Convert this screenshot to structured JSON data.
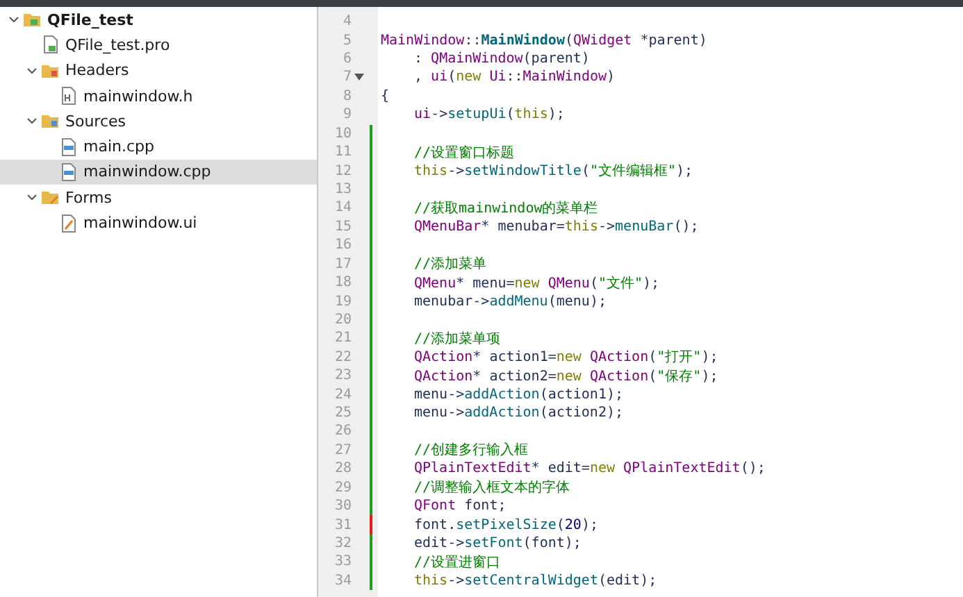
{
  "project_tree": [
    {
      "label": "QFile_test",
      "kind": "project",
      "expanded": true,
      "selected": false,
      "children": [
        {
          "label": "QFile_test.pro",
          "kind": "pro",
          "selected": false
        },
        {
          "label": "Headers",
          "kind": "headers",
          "expanded": true,
          "selected": false,
          "children": [
            {
              "label": "mainwindow.h",
              "kind": "header",
              "selected": false
            }
          ]
        },
        {
          "label": "Sources",
          "kind": "sources",
          "expanded": true,
          "selected": false,
          "children": [
            {
              "label": "main.cpp",
              "kind": "cpp",
              "selected": false
            },
            {
              "label": "mainwindow.cpp",
              "kind": "cpp",
              "selected": true
            }
          ]
        },
        {
          "label": "Forms",
          "kind": "forms",
          "expanded": true,
          "selected": false,
          "children": [
            {
              "label": "mainwindow.ui",
              "kind": "ui",
              "selected": false
            }
          ]
        }
      ]
    }
  ],
  "editor": {
    "lines": [
      {
        "number": "4",
        "added": false,
        "modified": false,
        "fold": false
      },
      {
        "number": "5",
        "added": false,
        "modified": false,
        "fold": false,
        "indented": false,
        "tokens": [
          {
            "kind": "type",
            "text": "MainWindow"
          },
          {
            "kind": "plain",
            "text": "::"
          },
          {
            "kind": "decl",
            "text": "MainWindow"
          },
          {
            "kind": "plain",
            "text": "("
          },
          {
            "kind": "type",
            "text": "QWidget"
          },
          {
            "kind": "plain",
            "text": " *parent)"
          }
        ]
      },
      {
        "number": "6",
        "added": false,
        "modified": false,
        "fold": false,
        "indented": true,
        "tokens": [
          {
            "kind": "plain",
            "text": ": "
          },
          {
            "kind": "type",
            "text": "QMainWindow"
          },
          {
            "kind": "plain",
            "text": "(parent)"
          }
        ]
      },
      {
        "number": "7",
        "added": false,
        "modified": false,
        "fold": true,
        "indented": true,
        "tokens": [
          {
            "kind": "plain",
            "text": ", "
          },
          {
            "kind": "type",
            "text": "ui"
          },
          {
            "kind": "plain",
            "text": "("
          },
          {
            "kind": "keyword",
            "text": "new"
          },
          {
            "kind": "type",
            "text": " Ui"
          },
          {
            "kind": "plain",
            "text": "::"
          },
          {
            "kind": "type",
            "text": "MainWindow"
          },
          {
            "kind": "plain",
            "text": ")"
          }
        ]
      },
      {
        "number": "8",
        "added": false,
        "modified": false,
        "fold": false,
        "indented": false,
        "tokens": [
          {
            "kind": "plain",
            "text": "{"
          }
        ]
      },
      {
        "number": "9",
        "added": false,
        "modified": false,
        "fold": false,
        "indented": true,
        "tokens": [
          {
            "kind": "type",
            "text": "ui"
          },
          {
            "kind": "plain",
            "text": "->"
          },
          {
            "kind": "func",
            "text": "setupUi"
          },
          {
            "kind": "plain",
            "text": "("
          },
          {
            "kind": "keyword",
            "text": "this"
          },
          {
            "kind": "plain",
            "text": ");"
          }
        ]
      },
      {
        "number": "10",
        "added": true,
        "modified": false,
        "fold": false
      },
      {
        "number": "11",
        "added": true,
        "modified": false,
        "fold": false,
        "indented": true,
        "tokens": [
          {
            "kind": "comment",
            "text": "//设置窗口标题"
          }
        ]
      },
      {
        "number": "12",
        "added": true,
        "modified": false,
        "fold": false,
        "indented": true,
        "tokens": [
          {
            "kind": "keyword",
            "text": "this"
          },
          {
            "kind": "plain",
            "text": "->"
          },
          {
            "kind": "func",
            "text": "setWindowTitle"
          },
          {
            "kind": "plain",
            "text": "("
          },
          {
            "kind": "string",
            "text": "\"文件编辑框\""
          },
          {
            "kind": "plain",
            "text": ");"
          }
        ]
      },
      {
        "number": "13",
        "added": true,
        "modified": false,
        "fold": false
      },
      {
        "number": "14",
        "added": true,
        "modified": false,
        "fold": false,
        "indented": true,
        "tokens": [
          {
            "kind": "comment",
            "text": "//获取mainwindow的菜单栏"
          }
        ]
      },
      {
        "number": "15",
        "added": true,
        "modified": false,
        "fold": false,
        "indented": true,
        "tokens": [
          {
            "kind": "type",
            "text": "QMenuBar"
          },
          {
            "kind": "plain",
            "text": "* menubar="
          },
          {
            "kind": "keyword",
            "text": "this"
          },
          {
            "kind": "plain",
            "text": "->"
          },
          {
            "kind": "func",
            "text": "menuBar"
          },
          {
            "kind": "plain",
            "text": "();"
          }
        ]
      },
      {
        "number": "16",
        "added": true,
        "modified": false,
        "fold": false
      },
      {
        "number": "17",
        "added": true,
        "modified": false,
        "fold": false,
        "indented": true,
        "tokens": [
          {
            "kind": "comment",
            "text": "//添加菜单"
          }
        ]
      },
      {
        "number": "18",
        "added": true,
        "modified": false,
        "fold": false,
        "indented": true,
        "tokens": [
          {
            "kind": "type",
            "text": "QMenu"
          },
          {
            "kind": "plain",
            "text": "* menu="
          },
          {
            "kind": "keyword",
            "text": "new"
          },
          {
            "kind": "type",
            "text": " QMenu"
          },
          {
            "kind": "plain",
            "text": "("
          },
          {
            "kind": "string",
            "text": "\"文件\""
          },
          {
            "kind": "plain",
            "text": ");"
          }
        ]
      },
      {
        "number": "19",
        "added": true,
        "modified": false,
        "fold": false,
        "indented": true,
        "tokens": [
          {
            "kind": "plain",
            "text": "menubar->"
          },
          {
            "kind": "func",
            "text": "addMenu"
          },
          {
            "kind": "plain",
            "text": "(menu);"
          }
        ]
      },
      {
        "number": "20",
        "added": true,
        "modified": false,
        "fold": false
      },
      {
        "number": "21",
        "added": true,
        "modified": false,
        "fold": false,
        "indented": true,
        "tokens": [
          {
            "kind": "comment",
            "text": "//添加菜单项"
          }
        ]
      },
      {
        "number": "22",
        "added": true,
        "modified": false,
        "fold": false,
        "indented": true,
        "tokens": [
          {
            "kind": "type",
            "text": "QAction"
          },
          {
            "kind": "plain",
            "text": "* action1="
          },
          {
            "kind": "keyword",
            "text": "new"
          },
          {
            "kind": "type",
            "text": " QAction"
          },
          {
            "kind": "plain",
            "text": "("
          },
          {
            "kind": "string",
            "text": "\"打开\""
          },
          {
            "kind": "plain",
            "text": ");"
          }
        ]
      },
      {
        "number": "23",
        "added": true,
        "modified": false,
        "fold": false,
        "indented": true,
        "tokens": [
          {
            "kind": "type",
            "text": "QAction"
          },
          {
            "kind": "plain",
            "text": "* action2="
          },
          {
            "kind": "keyword",
            "text": "new"
          },
          {
            "kind": "type",
            "text": " QAction"
          },
          {
            "kind": "plain",
            "text": "("
          },
          {
            "kind": "string",
            "text": "\"保存\""
          },
          {
            "kind": "plain",
            "text": ");"
          }
        ]
      },
      {
        "number": "24",
        "added": true,
        "modified": false,
        "fold": false,
        "indented": true,
        "tokens": [
          {
            "kind": "plain",
            "text": "menu->"
          },
          {
            "kind": "func",
            "text": "addAction"
          },
          {
            "kind": "plain",
            "text": "(action1);"
          }
        ]
      },
      {
        "number": "25",
        "added": true,
        "modified": false,
        "fold": false,
        "indented": true,
        "tokens": [
          {
            "kind": "plain",
            "text": "menu->"
          },
          {
            "kind": "func",
            "text": "addAction"
          },
          {
            "kind": "plain",
            "text": "(action2);"
          }
        ]
      },
      {
        "number": "26",
        "added": true,
        "modified": false,
        "fold": false
      },
      {
        "number": "27",
        "added": true,
        "modified": false,
        "fold": false,
        "indented": true,
        "tokens": [
          {
            "kind": "comment",
            "text": "//创建多行输入框"
          }
        ]
      },
      {
        "number": "28",
        "added": true,
        "modified": false,
        "fold": false,
        "indented": true,
        "tokens": [
          {
            "kind": "type",
            "text": "QPlainTextEdit"
          },
          {
            "kind": "plain",
            "text": "* edit="
          },
          {
            "kind": "keyword",
            "text": "new"
          },
          {
            "kind": "type",
            "text": " QPlainTextEdit"
          },
          {
            "kind": "plain",
            "text": "();"
          }
        ]
      },
      {
        "number": "29",
        "added": true,
        "modified": false,
        "fold": false,
        "indented": true,
        "tokens": [
          {
            "kind": "comment",
            "text": "//调整输入框文本的字体"
          }
        ]
      },
      {
        "number": "30",
        "added": true,
        "modified": false,
        "fold": false,
        "indented": true,
        "tokens": [
          {
            "kind": "type",
            "text": "QFont"
          },
          {
            "kind": "plain",
            "text": " font;"
          }
        ]
      },
      {
        "number": "31",
        "added": false,
        "modified": true,
        "fold": false,
        "indented": true,
        "tokens": [
          {
            "kind": "plain",
            "text": "font."
          },
          {
            "kind": "func",
            "text": "setPixelSize"
          },
          {
            "kind": "plain",
            "text": "("
          },
          {
            "kind": "number",
            "text": "20"
          },
          {
            "kind": "plain",
            "text": ");"
          }
        ]
      },
      {
        "number": "32",
        "added": true,
        "modified": false,
        "fold": false,
        "indented": true,
        "tokens": [
          {
            "kind": "plain",
            "text": "edit->"
          },
          {
            "kind": "func",
            "text": "setFont"
          },
          {
            "kind": "plain",
            "text": "(font);"
          }
        ]
      },
      {
        "number": "33",
        "added": true,
        "modified": false,
        "fold": false,
        "indented": true,
        "tokens": [
          {
            "kind": "comment",
            "text": "//设置进窗口"
          }
        ]
      },
      {
        "number": "34",
        "added": true,
        "modified": false,
        "fold": false,
        "indented": true,
        "tokens": [
          {
            "kind": "keyword",
            "text": "this"
          },
          {
            "kind": "plain",
            "text": "->"
          },
          {
            "kind": "func",
            "text": "setCentralWidget"
          },
          {
            "kind": "plain",
            "text": "(edit);"
          }
        ]
      }
    ]
  }
}
